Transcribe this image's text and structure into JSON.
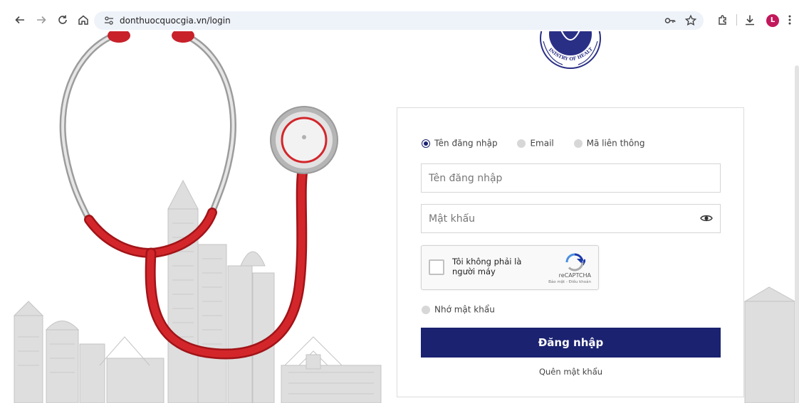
{
  "browser": {
    "url": "donthuocquocgia.vn/login",
    "profile_initial": "L",
    "icons": [
      "back-icon",
      "forward-icon",
      "reload-icon",
      "home-icon",
      "site-settings-icon",
      "password-key-icon",
      "bookmark-star-icon",
      "extensions-icon",
      "download-icon",
      "menu-dots-icon"
    ]
  },
  "logo": {
    "ring_text": "MINISTRY OF HEALTH"
  },
  "login": {
    "login_types": [
      {
        "label": "Tên đăng nhập",
        "selected": true
      },
      {
        "label": "Email",
        "selected": false
      },
      {
        "label": "Mã liên thông",
        "selected": false
      }
    ],
    "username_placeholder": "Tên đăng nhập",
    "password_placeholder": "Mật khẩu",
    "recaptcha": {
      "label": "Tôi không phải là người máy",
      "brand": "reCAPTCHA",
      "terms": "Bảo mật - Điều khoản"
    },
    "remember_label": "Nhớ mật khẩu",
    "submit_label": "Đăng nhập",
    "forgot_label": "Quên mật khẩu"
  },
  "colors": {
    "primary": "#1b2270",
    "stethoscope_red": "#d3262b",
    "avatar": "#c2185b"
  }
}
